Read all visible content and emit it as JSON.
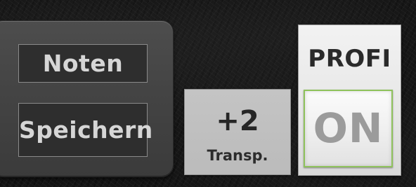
{
  "save_notes": {
    "line1": "Noten",
    "line2": "Speichern"
  },
  "transpose": {
    "value": "+2",
    "label": "Transp."
  },
  "profi": {
    "title": "PROFI",
    "state_label": "ON",
    "state_on": true,
    "highlight_color": "#8fc25c"
  }
}
